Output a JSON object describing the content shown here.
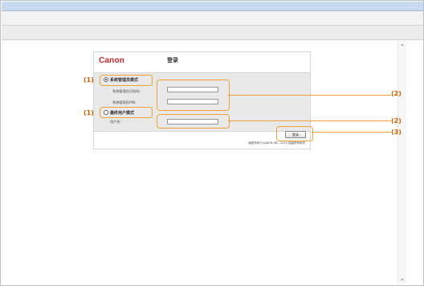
{
  "address_bar": {
    "value": ""
  },
  "login_panel": {
    "logo_text": "Canon",
    "title": "登录",
    "admin_mode_label": "系统管理员模式",
    "admin_id_label": "系统管理员识别码:",
    "admin_pin_label": "系统管理员PIN:",
    "user_mode_label": "最终用户模式",
    "username_label": "用户名:",
    "login_button": "登录",
    "copyright": "版权所有©CANON INC. 2013 保留所有权利"
  },
  "callouts": {
    "admin_mode": "(1)",
    "user_mode": "(1)",
    "id_pin_fields": "(2)",
    "username_field": "(2)",
    "login_button": "(3)"
  }
}
